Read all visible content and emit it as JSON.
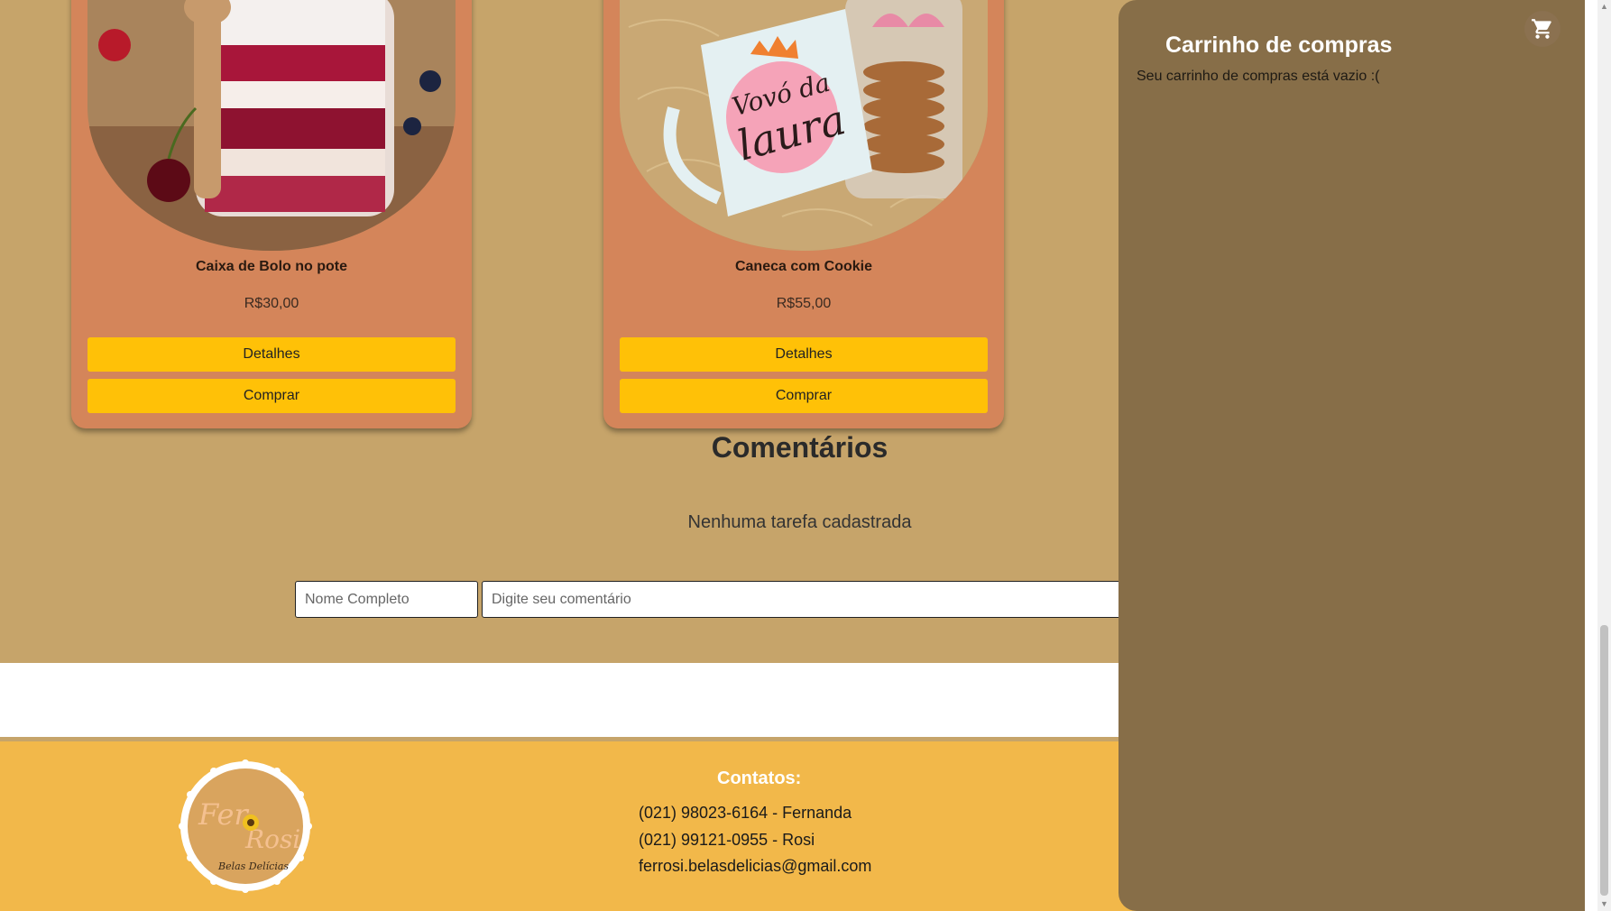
{
  "products": [
    {
      "title": "Caixa de Bolo no pote",
      "price": "R$30,00",
      "details_label": "Detalhes",
      "buy_label": "Comprar"
    },
    {
      "title": "Caneca com Cookie",
      "price": "R$55,00",
      "details_label": "Detalhes",
      "buy_label": "Comprar"
    }
  ],
  "comments": {
    "title": "Comentários",
    "empty_message": "Nenhuma tarefa cadastrada",
    "name_placeholder": "Nome Completo",
    "comment_placeholder": "Digite seu comentário"
  },
  "footer": {
    "contacts_title": "Contatos:",
    "contact_1": "(021) 98023-6164 - Fernanda",
    "contact_2": "(021) 99121-0955 - Rosi",
    "email": "ferrosi.belasdelicias@gmail.com",
    "logo_text_1": "Fer",
    "logo_text_2": "Rosi",
    "logo_subtext": "Belas Delícias"
  },
  "cart": {
    "title": "Carrinho de compras",
    "empty_message": "Seu carrinho de compras está vazio :(",
    "icon": "shopping-cart-icon"
  },
  "colors": {
    "page_bg": "#c6a46a",
    "card_bg": "#d4855a",
    "button_bg": "#ffc107",
    "footer_bg": "#f2b84a",
    "cart_bg": "#876e48"
  }
}
